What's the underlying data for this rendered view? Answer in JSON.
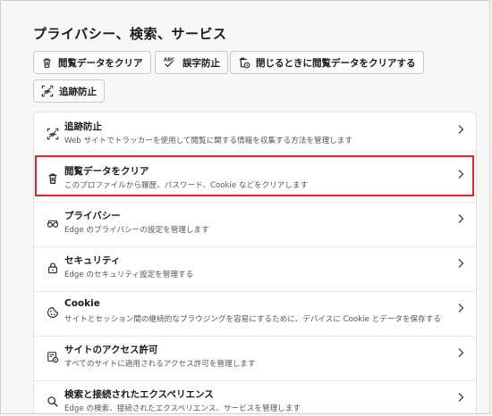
{
  "page": {
    "title": "プライバシー、検索、サービス"
  },
  "chips": [
    {
      "label": "閲覧データをクリア",
      "icon": "trash-icon"
    },
    {
      "label": "誤字防止",
      "icon": "spellcheck-icon"
    },
    {
      "label": "閉じるときに閲覧データをクリアする",
      "icon": "clear-on-close-icon"
    },
    {
      "label": "追跡防止",
      "icon": "tracking-prevention-icon"
    }
  ],
  "rows": [
    {
      "title": "追跡防止",
      "sub": "Web サイトでトラッカーを使用して閲覧に関する情報を収集する方法を管理します",
      "icon": "tracking-prevention-icon"
    },
    {
      "title": "閲覧データをクリア",
      "sub": "このプロファイルから履歴、パスワード、Cookie などをクリアします",
      "icon": "trash-icon"
    },
    {
      "title": "プライバシー",
      "sub": "Edge のプライバシーの設定を管理します",
      "icon": "glasses-icon"
    },
    {
      "title": "セキュリティ",
      "sub": "Edge のセキュリティ設定を管理する",
      "icon": "lock-icon"
    },
    {
      "title": "Cookie",
      "sub": "サイトとセッション間の継続的なブラウジングを容易にするために、デバイスに Cookie とデータを保存する",
      "icon": "cookie-icon"
    },
    {
      "title": "サイトのアクセス許可",
      "sub": "すべてのサイトに適用されるアクセス許可を管理します",
      "icon": "site-permissions-icon"
    },
    {
      "title": "検索と接続されたエクスペリエンス",
      "sub": "Edge の検索、接続されたエクスペリエンス、サービスを管理します",
      "icon": "search-icon"
    }
  ],
  "colors": {
    "highlight": "#e4262b"
  }
}
